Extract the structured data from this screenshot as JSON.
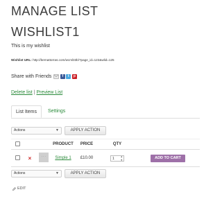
{
  "page": {
    "title": "MANAGE LIST",
    "wishlist_title": "WISHLIST1",
    "description": "This is my wishlist"
  },
  "wishlist_url": {
    "label": "Wishlist URL:",
    "value": "http://bernattorras.com/wcml33b/?page_id=122&wlid=125"
  },
  "share": {
    "label": "Share with Friends",
    "icons": [
      "email-icon",
      "facebook-icon",
      "twitter-icon",
      "pinterest-icon"
    ]
  },
  "links": {
    "delete": "Delete list",
    "separator": "|",
    "preview": "Preview List"
  },
  "tabs": [
    {
      "label": "List Items",
      "active": true
    },
    {
      "label": "Settings",
      "active": false
    }
  ],
  "actions": {
    "select_value": "Actions",
    "apply_label": "APPLY ACTION"
  },
  "table": {
    "headers": {
      "product": "PRODUCT",
      "price": "PRICE",
      "qty": "QTY"
    },
    "rows": [
      {
        "remove": "×",
        "thumb": "···",
        "product": "Simple 1",
        "price": "£10.00",
        "qty": "1",
        "add_to_cart": "ADD TO CART"
      }
    ]
  },
  "footer": {
    "edit_label": "EDIT"
  },
  "colors": {
    "link": "#2a8a3a",
    "add_to_cart_bg": "#9e70a8",
    "remove": "#cc2222",
    "facebook": "#3b5998",
    "twitter": "#4aa8e0",
    "pinterest": "#cb2027"
  }
}
